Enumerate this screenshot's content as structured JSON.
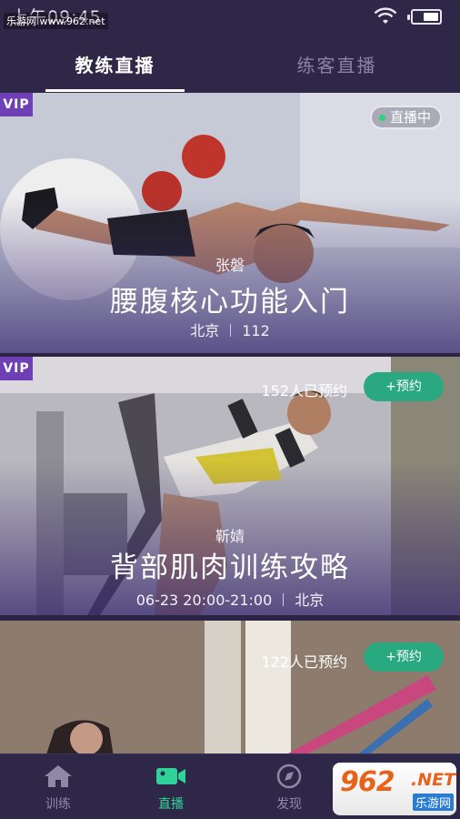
{
  "status_bar": {
    "time": "上午09:45",
    "watermark": "乐游网 www.962.net"
  },
  "tabs": [
    {
      "label": "教练直播",
      "active": true
    },
    {
      "label": "练客直播",
      "active": false
    }
  ],
  "cards": [
    {
      "badge": "VIP",
      "status": "直播中",
      "coach": "张磐",
      "course": "腰腹核心功能入门",
      "city": "北京",
      "viewers": "112"
    },
    {
      "badge": "VIP",
      "booked": "152人已预约",
      "button": "+预约",
      "coach": "靳婧",
      "course": "背部肌肉训练攻略",
      "time": "06-23 20:00-21:00",
      "city": "北京"
    },
    {
      "booked": "122人已预约",
      "button": "+预约"
    }
  ],
  "bottom_nav": [
    {
      "label": "训练",
      "icon": "home-icon",
      "active": false
    },
    {
      "label": "直播",
      "icon": "video-camera-icon",
      "active": true
    },
    {
      "label": "发现",
      "icon": "compass-icon",
      "active": false
    }
  ],
  "logo": {
    "number": "962",
    "suffix": ".NET",
    "site": "乐游网"
  },
  "colors": {
    "background": "#2f2747",
    "accent_green": "#2aa87f",
    "vip_purple": "#6f3fb5",
    "live_dot": "#29d27d"
  }
}
